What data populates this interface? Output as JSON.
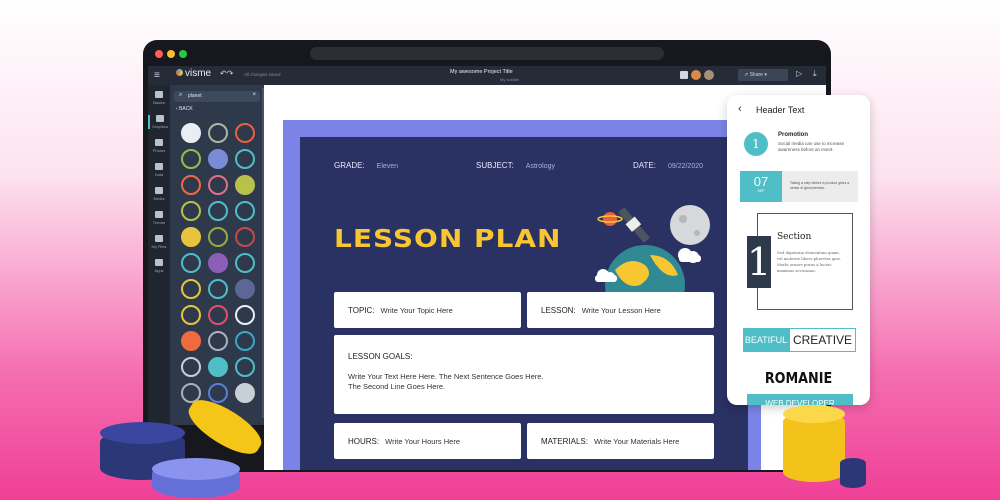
{
  "app": {
    "logo": "visme",
    "save_status": "All changes saved",
    "project_title": "My awesome Project Title",
    "project_subtitle": "My subtitle",
    "share_label": "Share"
  },
  "sidebar": {
    "items": [
      {
        "label": "Basics"
      },
      {
        "label": "Graphics"
      },
      {
        "label": "Photos"
      },
      {
        "label": "Data"
      },
      {
        "label": "Media"
      },
      {
        "label": "Theme"
      },
      {
        "label": "My Files"
      },
      {
        "label": "Apps"
      }
    ]
  },
  "panel": {
    "search_value": "planet",
    "back_label": "BACK",
    "icons": [
      [
        "planet-ring-white",
        "#e8eef4"
      ],
      [
        "globe-grid",
        "#a9b7a4"
      ],
      [
        "saturn",
        "#e9603f"
      ],
      [
        "rocket-green",
        "#8bc34a"
      ],
      [
        "space-shuttle",
        "#7a8cd6"
      ],
      [
        "globe-outline",
        "#4fbec7"
      ],
      [
        "rocket-orange",
        "#ef6a3c"
      ],
      [
        "rocket-pink",
        "#e0708a"
      ],
      [
        "globe-pin",
        "#b8c24a"
      ],
      [
        "globe-hand",
        "#b8c24a"
      ],
      [
        "globe-small",
        "#4fbec7"
      ],
      [
        "globe-rotate",
        "#4fbec7"
      ],
      [
        "planet-yellow",
        "#e8c33c"
      ],
      [
        "planet-green",
        "#9aab3e"
      ],
      [
        "globe-red",
        "#c7474a"
      ],
      [
        "earth-small",
        "#4fbec7"
      ],
      [
        "tag-globe",
        "#8b5fb5"
      ],
      [
        "globe-frame",
        "#4fbec7"
      ],
      [
        "mars-rover",
        "#e8c33c"
      ],
      [
        "globe-card",
        "#4fbec7"
      ],
      [
        "globe-dark",
        "#5c6796"
      ],
      [
        "phone-globe",
        "#e8c33c"
      ],
      [
        "flag-planet",
        "#e0506a"
      ],
      [
        "moon-base",
        "#e8eef4"
      ],
      [
        "cart-globe",
        "#ef6a3c"
      ],
      [
        "globe-gray",
        "#aab1b8"
      ],
      [
        "earth-blue",
        "#3aa7c9"
      ],
      [
        "planet-cloud",
        "#c9cfd6"
      ],
      [
        "globe-network",
        "#4fbec7"
      ],
      [
        "laptop-globe",
        "#4fbec7"
      ],
      [
        "globe-magnifier",
        "#aab1b8"
      ],
      [
        "globe-people",
        "#5a7fd6"
      ],
      [
        "globe-device",
        "#c9cfd6"
      ]
    ]
  },
  "lesson": {
    "grade_label": "GRADE:",
    "grade": "Eleven",
    "subject_label": "SUBJECT:",
    "subject": "Astrology",
    "date_label": "DATE:",
    "date": "09/22/2020",
    "title": "LESSON PLAN",
    "topic_label": "TOPIC:",
    "topic": "Write Your Topic Here",
    "lesson_label": "LESSON:",
    "lesson": "Write Your Lesson Here",
    "goals_label": "LESSON GOALS:",
    "goals_line1": "Write Your Text Here Here. The Next Sentence Goes Here.",
    "goals_line2": "The Second Line Goes Here.",
    "hours_label": "HOURS:",
    "hours": "Write Your Hours Here",
    "materials_label": "MATERIALS:",
    "materials": "Write Your Materials Here"
  },
  "card": {
    "title": "Header Text",
    "promo_number": "1",
    "promo_title": "Promotion",
    "promo_text": "Social media can use to increase awareness before an event.",
    "date_day": "07",
    "date_month": "SEP",
    "date_text": "Taking a step before a product gives a sense of genuineness.",
    "section_number": "1",
    "section_title": "Section",
    "section_text": "Sed dignissim elementum quam, vel molestie libero pharetra quis. Morbi ornare purus a luctus maximus accumsan.",
    "beatiful": "BEATIFUL",
    "creative": "CREATIVE",
    "romanie": "ROMANIE",
    "banner": "WEB DEVELOPER"
  },
  "colors": {
    "accent": "#4fbec7",
    "sheet": "#2a3163",
    "frame": "#7b84e6",
    "title": "#f7c631",
    "background": "#ef3f96"
  }
}
